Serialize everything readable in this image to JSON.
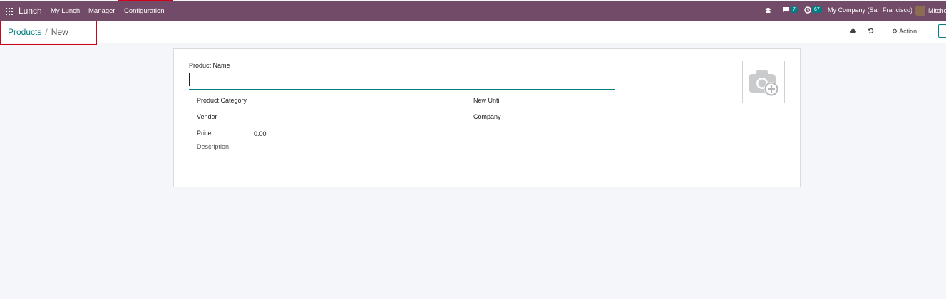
{
  "navbar": {
    "app_name": "Lunch",
    "menu": [
      "My Lunch",
      "Manager",
      "Configuration"
    ],
    "messages_count": "7",
    "activities_count": "67",
    "company": "My Company (San Francisco)",
    "user": "Mitche"
  },
  "breadcrumb": {
    "parent": "Products",
    "separator": "/",
    "current": "New"
  },
  "control": {
    "action_label": "Action"
  },
  "form": {
    "product_name_label": "Product Name",
    "product_name_value": "",
    "product_category_label": "Product Category",
    "vendor_label": "Vendor",
    "price_label": "Price",
    "price_value": "0.00",
    "description_label": "Description",
    "new_until_label": "New Until",
    "company_label": "Company"
  },
  "colors": {
    "navbar": "#714b67",
    "accent": "#017e84",
    "highlight": "#d0021b"
  }
}
